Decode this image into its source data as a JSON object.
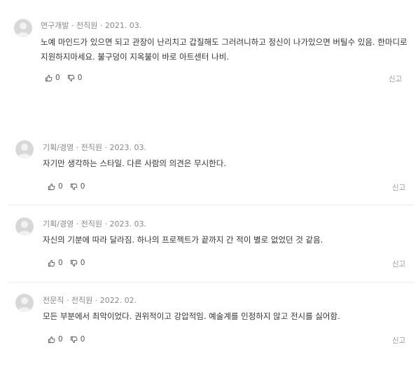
{
  "reviews": [
    {
      "author": "연구개발 · 전직원 · 2021. 03.",
      "text": "노예 마인드가 있으면 되고 관장이 난리치고 갑질해도 그러려니하고 정신이 나가있으면 버틸수 있음. 한마디로 지원하지마세요. 불구덩이 지옥불이 바로 아트센터 나비.",
      "likes": "0",
      "dislikes": "0",
      "report": "신고"
    },
    {
      "author": "기획/경영 · 전직원 · 2023. 03.",
      "text": "자기만 생각하는 스타일. 다른 사람의 의견은 무시한다.",
      "likes": "0",
      "dislikes": "0",
      "report": "신고"
    },
    {
      "author": "기획/경영 · 전직원 · 2023. 03.",
      "text": "자신의 기분에 따라 달라짐. 하나의 프로젝트가 끝까지 간 적이 별로 없었던 것 같음.",
      "likes": "0",
      "dislikes": "0",
      "report": "신고"
    },
    {
      "author": "전문직 · 전직원 · 2022. 02.",
      "text": "모든 부분에서 최악이었다. 권위적이고 강압적임. 예술계를 인정하지 않고 전시를 싫어함.",
      "likes": "0",
      "dislikes": "0",
      "report": "신고"
    }
  ],
  "colors": {
    "avatar_bg": "#d8d8d8",
    "meta": "#888888",
    "text": "#333333",
    "report": "#9a9a9a"
  },
  "icons": {
    "avatar": "user-avatar-icon",
    "like": "thumbs-up-icon",
    "dislike": "thumbs-down-icon"
  }
}
